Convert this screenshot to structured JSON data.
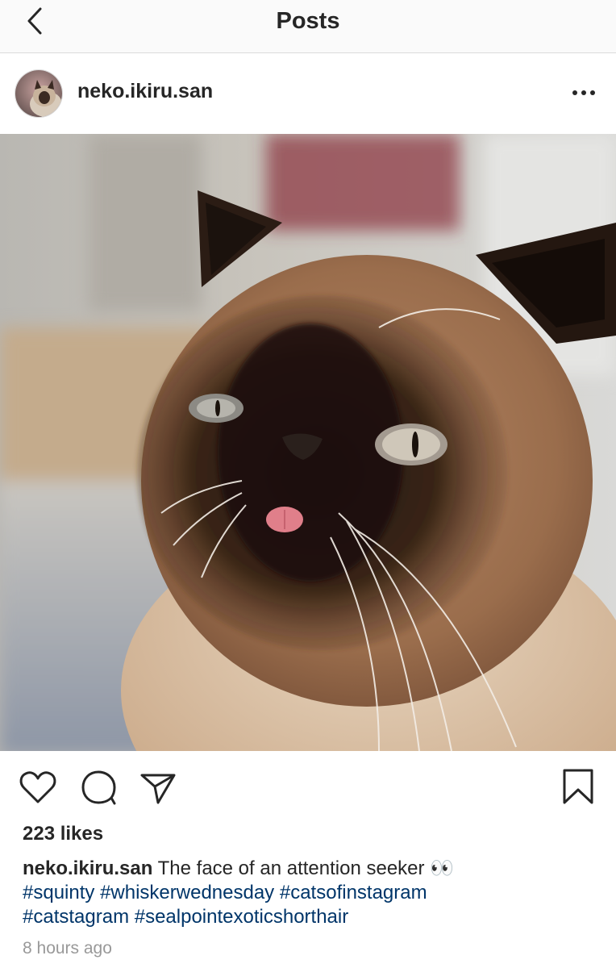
{
  "header": {
    "title": "Posts",
    "back_icon": "chevron-left-icon"
  },
  "post": {
    "username": "neko.ikiru.san",
    "more_icon": "more-horizontal-icon",
    "image_subject": "seal point exotic shorthair cat with tongue out",
    "likes_label": "223 likes",
    "caption_user": "neko.ikiru.san",
    "caption_text": " The face of an attention seeker ",
    "caption_emoji": "👀",
    "hashtags": [
      "#squinty",
      "#whiskerwednesday",
      "#catsofinstagram",
      "#catstagram",
      "#sealpointexoticshorthair"
    ],
    "timestamp": "8 hours ago"
  },
  "actions": {
    "like_icon": "heart-icon",
    "comment_icon": "comment-icon",
    "share_icon": "paper-plane-icon",
    "save_icon": "bookmark-icon"
  },
  "colors": {
    "text": "#262626",
    "hashtag": "#003569",
    "muted": "#999999",
    "divider": "#dbdbdb",
    "topbar_bg": "#fafafa"
  }
}
